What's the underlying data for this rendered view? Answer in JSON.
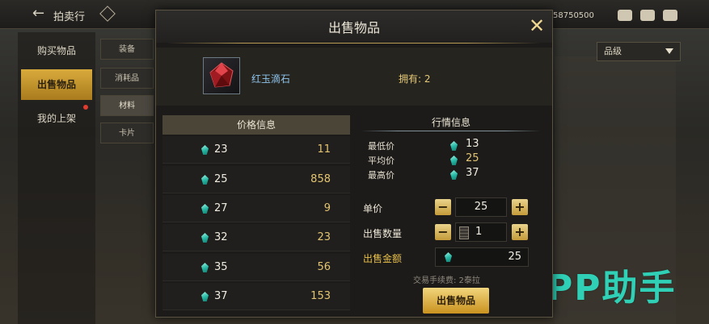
{
  "topbar": {
    "back_icon": "arrow-left-icon",
    "title": "拍卖行",
    "currency_text": "58750500"
  },
  "sidebar": {
    "items": [
      {
        "label": "购买物品"
      },
      {
        "label": "出售物品"
      },
      {
        "label": "我的上架"
      }
    ]
  },
  "subtabs": {
    "items": [
      {
        "label": "装备"
      },
      {
        "label": "消耗品"
      },
      {
        "label": "材料"
      },
      {
        "label": "卡片"
      }
    ]
  },
  "filter": {
    "grade_label": "品级"
  },
  "watermark": {
    "text": "PP助手"
  },
  "modal": {
    "title": "出售物品",
    "item": {
      "name": "红玉滴石",
      "owned_text": "拥有: 2"
    },
    "price_info_title": "价格信息",
    "price_list": [
      {
        "price": "23",
        "quantity": "11"
      },
      {
        "price": "25",
        "quantity": "858"
      },
      {
        "price": "27",
        "quantity": "9"
      },
      {
        "price": "32",
        "quantity": "23"
      },
      {
        "price": "35",
        "quantity": "56"
      },
      {
        "price": "37",
        "quantity": "153"
      }
    ],
    "market_info": {
      "title": "行情信息",
      "lowest_label": "最低价",
      "lowest_value": "13",
      "average_label": "平均价",
      "average_value": "25",
      "highest_label": "最高价",
      "highest_value": "37"
    },
    "form": {
      "unit_price_label": "单价",
      "unit_price_value": "25",
      "quantity_label": "出售数量",
      "quantity_value": "1",
      "total_label": "出售金额",
      "total_value": "25",
      "minus_symbol": "−",
      "plus_symbol": "+"
    },
    "fee_note": "交易手续费: 2泰拉",
    "sell_button_label": "出售物品"
  },
  "colors": {
    "accent_gold": "#d9ab3c",
    "gem_teal": "#23b5a2",
    "item_name_blue": "#8fc6ee",
    "watermark_teal": "#2fd0b6"
  }
}
